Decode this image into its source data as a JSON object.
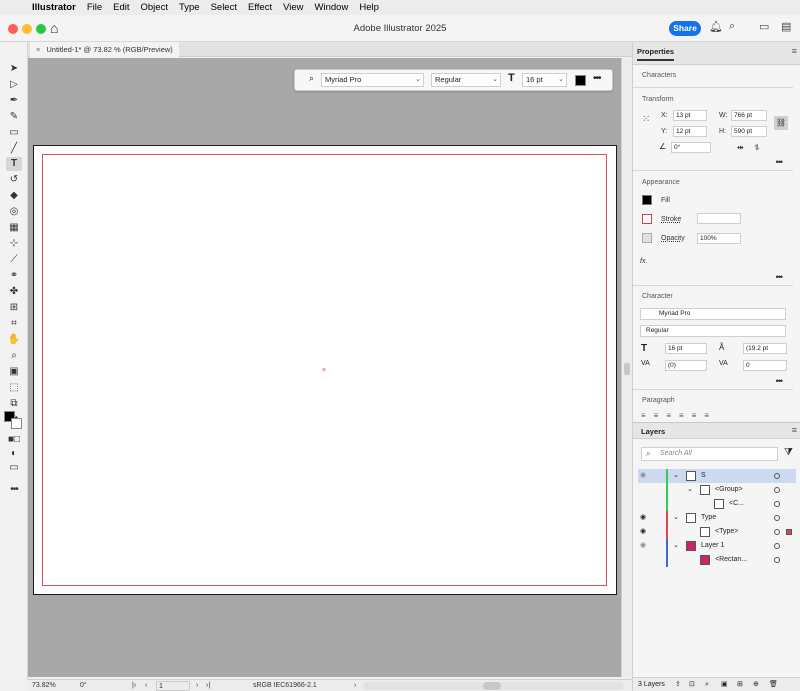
{
  "menubar": {
    "items": [
      "Illustrator",
      "File",
      "Edit",
      "Object",
      "Type",
      "Select",
      "Effect",
      "View",
      "Window",
      "Help"
    ]
  },
  "titlebar": {
    "title": "Adobe Illustrator 2025",
    "share_label": "Share"
  },
  "document": {
    "tab_label": "Untitled-1* @ 73.82 % (RGB/Preview)",
    "close_glyph": "×"
  },
  "controlbar": {
    "font_family": "Myriad Pro",
    "font_style": "Regular",
    "font_size": "16 pt",
    "fill_color": "#000000"
  },
  "properties": {
    "tab_label": "Properties",
    "characters_label": "Characters",
    "transform": {
      "label": "Transform",
      "x_label": "X:",
      "x_value": "13 pt",
      "y_label": "Y:",
      "y_value": "12 pt",
      "w_label": "W:",
      "w_value": "766 pt",
      "h_label": "H:",
      "h_value": "590 pt",
      "angle_value": "0°"
    },
    "appearance": {
      "label": "Appearance",
      "fill_label": "Fill",
      "stroke_label": "Stroke",
      "opacity_label": "Opacity",
      "opacity_value": "100%",
      "fx_label": "fx."
    },
    "character": {
      "label": "Character",
      "font_family": "Myriad Pro",
      "font_style": "Regular",
      "size_value": "16 pt",
      "leading_value": "(19.2 pt",
      "kerning_value": "(0)",
      "tracking_value": "0"
    },
    "paragraph_label": "Paragraph"
  },
  "layers": {
    "tab_label": "Layers",
    "search_placeholder": "Search All",
    "rows": [
      {
        "name": "S",
        "bar_color": "#33cc55",
        "selected": true
      },
      {
        "name": "<Group>",
        "bar_color": "#33cc55"
      },
      {
        "name": "<C...",
        "bar_color": "#33cc55"
      },
      {
        "name": "Type",
        "bar_color": "#dd4455"
      },
      {
        "name": "<Type>",
        "bar_color": "#dd4455"
      },
      {
        "name": "Layer 1",
        "bar_color": "#4466dd"
      },
      {
        "name": "<Rectan...",
        "bar_color": "#4466dd"
      }
    ],
    "footer_count": "3 Layers"
  },
  "statusbar": {
    "zoom": "73.82%",
    "rotation": "0°",
    "artboard_number": "1",
    "color_profile": "sRGB IEC61966-2.1"
  },
  "colors": {
    "accent": "#1473e6",
    "artboard_margin": "#e05060",
    "canvas_bg": "#a8a8a8"
  }
}
